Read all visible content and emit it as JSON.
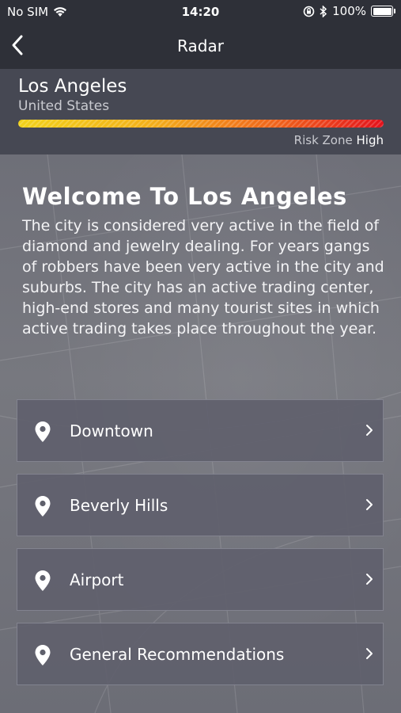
{
  "status_bar": {
    "carrier": "No SIM",
    "time": "14:20",
    "battery_percent": "100%",
    "icons": [
      "wifi-icon",
      "orientation-lock-icon",
      "bluetooth-icon",
      "battery-icon"
    ]
  },
  "nav": {
    "title": "Radar",
    "back_icon": "chevron-left-icon"
  },
  "city": {
    "name": "Los Angeles",
    "country": "United States",
    "risk_label": "Risk Zone",
    "risk_level": "High",
    "risk_gradient": [
      "#f2d21a",
      "#f0651b",
      "#e4121c"
    ]
  },
  "welcome": {
    "title": "Welcome To Los Angeles",
    "description": "The city is considered very active in the field of diamond and jewelry dealing. For years gangs of robbers have been very active in the city and suburbs. The city has an active trading center, high-end stores and many tourist sites in which active trading takes place throughout the year."
  },
  "locations": [
    {
      "label": "Downtown",
      "icon": "location-pin-icon"
    },
    {
      "label": "Beverly Hills",
      "icon": "location-pin-icon"
    },
    {
      "label": "Airport",
      "icon": "location-pin-icon"
    },
    {
      "label": "General Recommendations",
      "icon": "location-pin-icon"
    }
  ]
}
